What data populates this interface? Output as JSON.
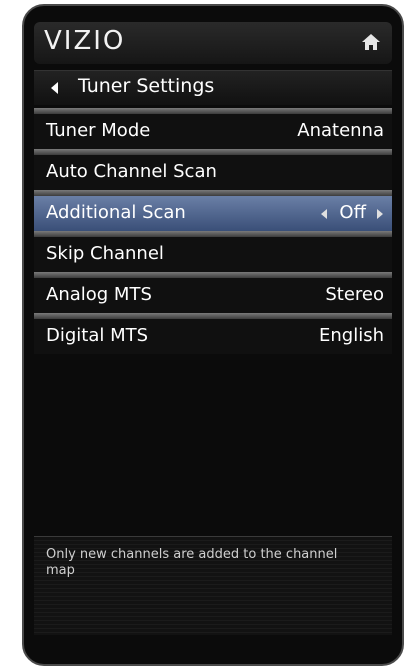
{
  "header": {
    "logo": "VIZIO",
    "home_icon": "home-icon"
  },
  "titlebar": {
    "back_icon": "back-arrow-icon",
    "title": "Tuner Settings"
  },
  "menu": {
    "items": [
      {
        "label": "Tuner Mode",
        "value": "Anatenna"
      },
      {
        "label": "Auto Channel Scan",
        "value": ""
      },
      {
        "label": "Additional Scan",
        "value": "Off",
        "selected": true
      },
      {
        "label": "Skip Channel",
        "value": ""
      },
      {
        "label": "Analog MTS",
        "value": "Stereo"
      },
      {
        "label": "Digital MTS",
        "value": "English"
      }
    ]
  },
  "help": {
    "text": "Only new channels are added to the channel map"
  },
  "colors": {
    "selected_row": "#4f6490",
    "background": "#0b0b0b",
    "text": "#ffffff"
  }
}
